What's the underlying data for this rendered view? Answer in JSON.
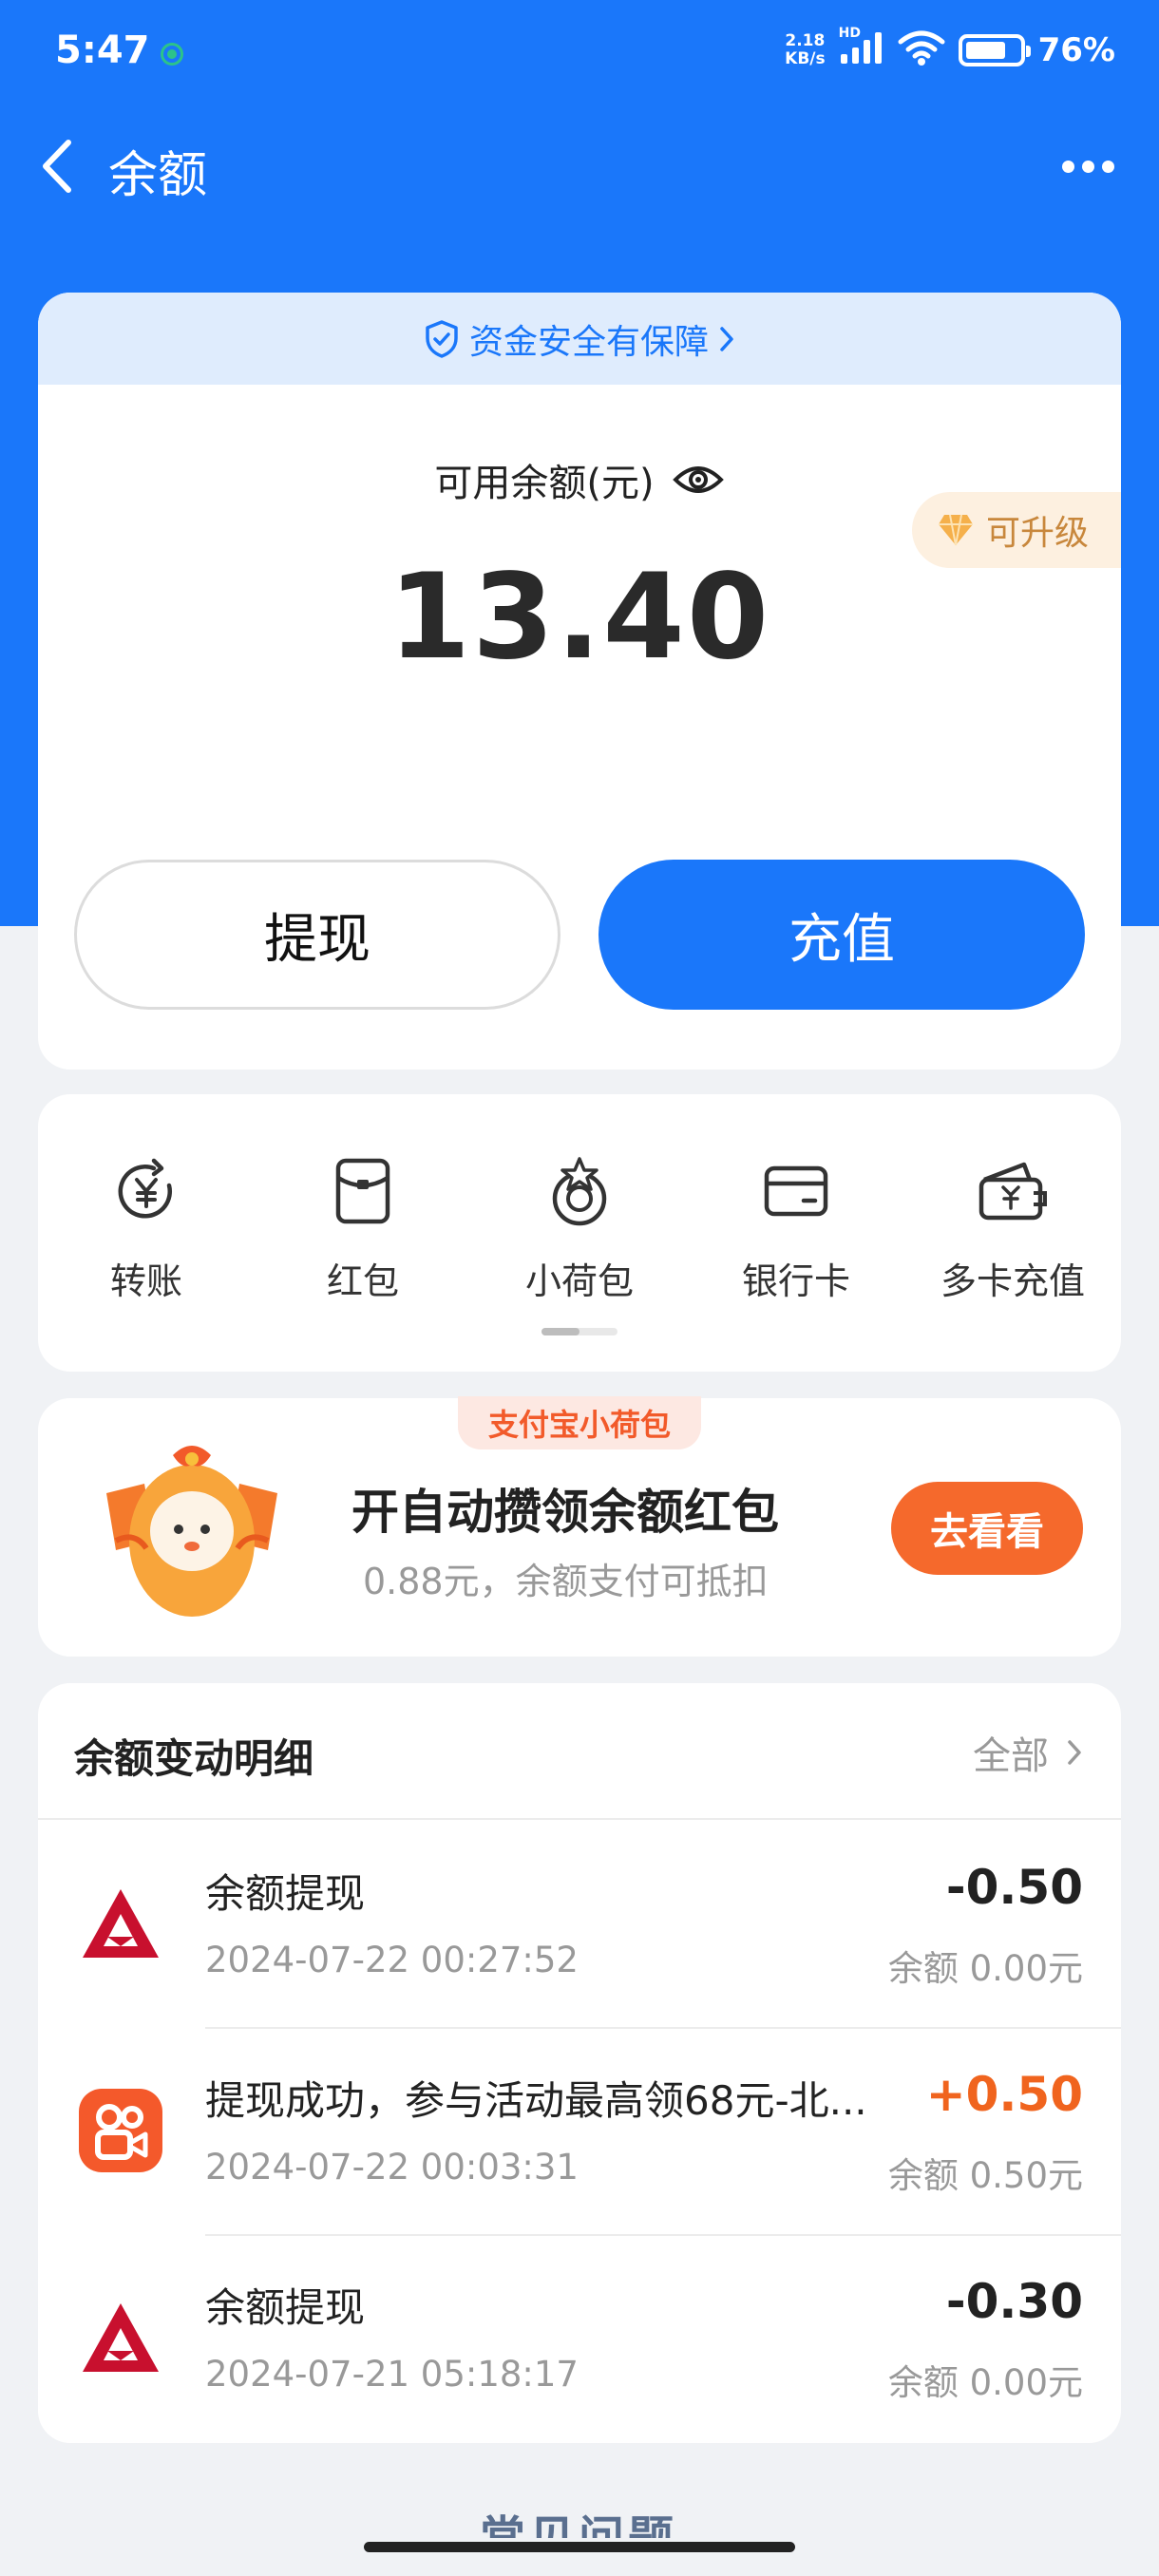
{
  "status_bar": {
    "time": "5:47",
    "net_speed": "2.18",
    "net_unit": "KB/s",
    "hd": "HD",
    "battery": "76%"
  },
  "nav": {
    "title": "余额"
  },
  "balance": {
    "safety_text": "资金安全有保障",
    "label": "可用余额(元)",
    "amount": "13.40",
    "upgrade": "可升级",
    "withdraw_label": "提现",
    "recharge_label": "充值"
  },
  "actions": [
    {
      "label": "转账",
      "icon": "transfer-icon"
    },
    {
      "label": "红包",
      "icon": "red-packet-icon"
    },
    {
      "label": "小荷包",
      "icon": "small-purse-icon"
    },
    {
      "label": "银行卡",
      "icon": "bank-card-icon"
    },
    {
      "label": "多卡充值",
      "icon": "multi-card-recharge-icon"
    }
  ],
  "promo": {
    "tag": "支付宝小荷包",
    "title": "开自动攒领余额红包",
    "subtitle": "0.88元，余额支付可抵扣",
    "button": "去看看"
  },
  "detail": {
    "title": "余额变动明细",
    "all_label": "全部",
    "rows": [
      {
        "title": "余额提现",
        "time": "2024-07-22 00:27:52",
        "amount": "-0.50",
        "balance": "余额 0.00元",
        "icon": "bank-logo-icon"
      },
      {
        "title": "提现成功，参与活动最高领68元-北...",
        "time": "2024-07-22 00:03:31",
        "amount": "+0.50",
        "balance": "余额 0.50元",
        "icon": "kuaishou-logo-icon"
      },
      {
        "title": "余额提现",
        "time": "2024-07-21 05:18:17",
        "amount": "-0.30",
        "balance": "余额 0.00元",
        "icon": "bank-logo-icon"
      }
    ]
  },
  "faq_peek": "常见问题",
  "colors": {
    "primary": "#1a77fa",
    "promo_orange": "#f5692c",
    "plus_amount": "#f0641e",
    "bank_red": "#c8102e"
  }
}
